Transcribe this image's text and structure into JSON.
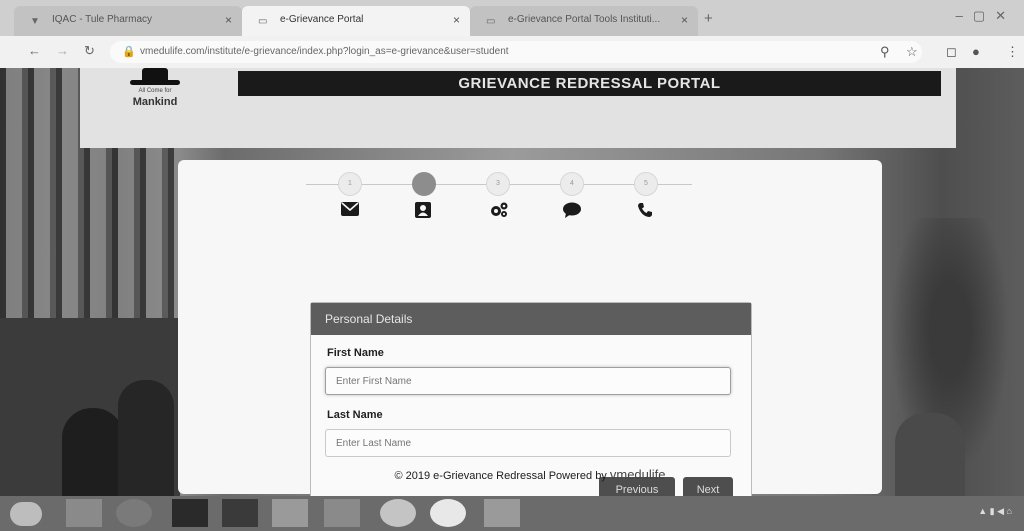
{
  "browser": {
    "tabs": [
      {
        "title": "IQAC - Tule Pharmacy",
        "active": false
      },
      {
        "title": "e-Grievance Portal",
        "active": true
      },
      {
        "title": "e-Grievance Portal Tools Instituti...",
        "active": false
      }
    ],
    "new_tab": "+",
    "url": "vmedulife.com/institute/e-grievance/index.php?login_as=e-grievance&user=student"
  },
  "header": {
    "logo_small": "All Come for",
    "logo_name": "Mankind",
    "title": "GRIEVANCE REDRESSAL PORTAL"
  },
  "wizard": {
    "steps": [
      {
        "icon": "envelope-icon",
        "active": false
      },
      {
        "icon": "contact-card-icon",
        "active": true
      },
      {
        "icon": "cogs-icon",
        "active": false
      },
      {
        "icon": "comment-icon",
        "active": false
      },
      {
        "icon": "phone-icon",
        "active": false
      }
    ]
  },
  "form": {
    "panel_title": "Personal Details",
    "first_name_label": "First Name",
    "first_name_placeholder": "Enter First Name",
    "last_name_label": "Last Name",
    "last_name_placeholder": "Enter Last Name",
    "previous_label": "Previous",
    "next_label": "Next"
  },
  "footer": {
    "text": "© 2019 e-Grievance Redressal Powered by",
    "brand": "vmedulife"
  }
}
